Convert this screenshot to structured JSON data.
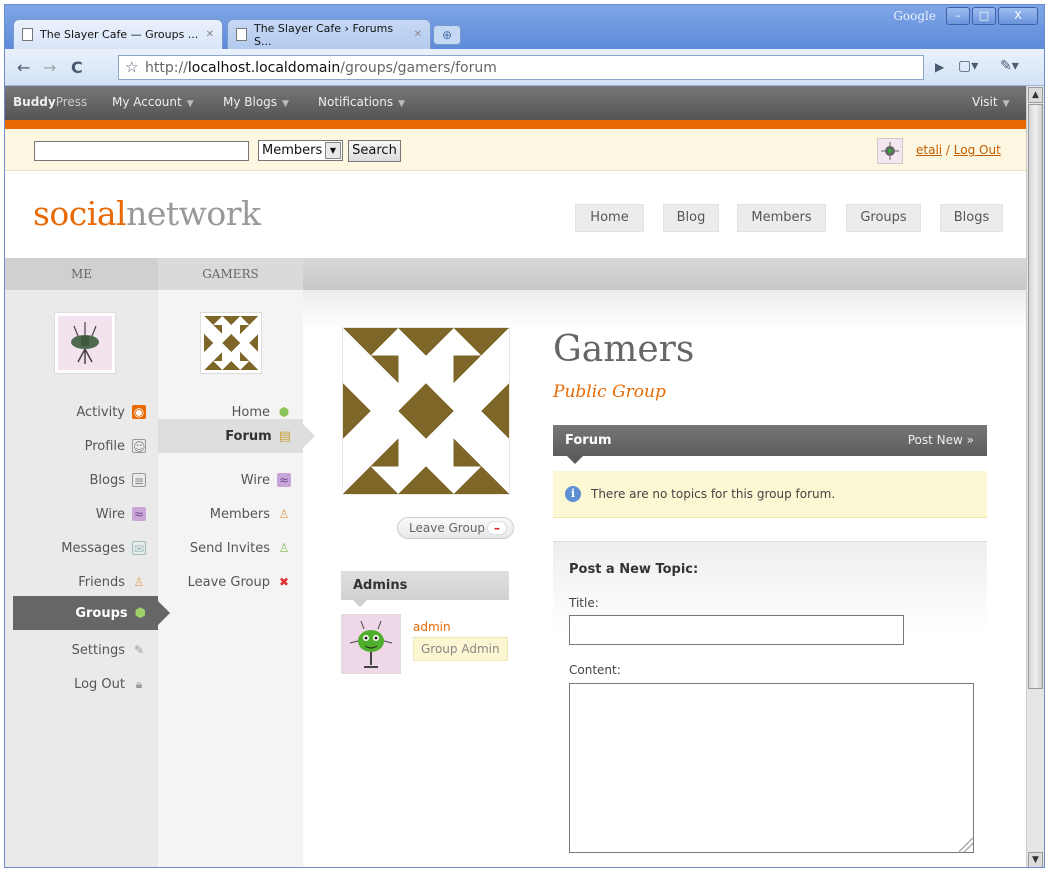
{
  "browser": {
    "tabs": [
      {
        "title": "The Slayer Cafe — Groups ..."
      },
      {
        "title": "The Slayer Cafe › Forums S..."
      }
    ],
    "brand_label": "Google",
    "url_prefix": "http://",
    "url_host": "localhost.localdomain",
    "url_path": "/groups/gamers/forum"
  },
  "adminbar": {
    "brand_a": "Buddy",
    "brand_b": "Press",
    "items": [
      "My Account",
      "My Blogs",
      "Notifications"
    ],
    "visit": "Visit"
  },
  "search": {
    "input_value": "",
    "scope": "Members",
    "button": "Search"
  },
  "user": {
    "name": "etali",
    "separator": " / ",
    "logout": "Log Out"
  },
  "header": {
    "logo_a": "social",
    "logo_b": "network",
    "nav": [
      "Home",
      "Blog",
      "Members",
      "Groups",
      "Blogs"
    ]
  },
  "columns": {
    "me_label": "ME",
    "group_label": "GAMERS"
  },
  "me_menu": {
    "items": [
      "Activity",
      "Profile",
      "Blogs",
      "Wire",
      "Messages",
      "Friends",
      "Groups",
      "Settings",
      "Log Out"
    ],
    "active": "Groups"
  },
  "group_menu": {
    "items": [
      "Home",
      "Forum",
      "Wire",
      "Members",
      "Send Invites",
      "Leave Group"
    ],
    "active": "Forum"
  },
  "group": {
    "name": "Gamers",
    "type": "Public Group",
    "leave_button": "Leave Group",
    "admins_heading": "Admins",
    "admin_name": "admin",
    "admin_badge": "Group Admin"
  },
  "forum": {
    "heading": "Forum",
    "post_new": "Post New »",
    "notice": "There are no topics for this group forum.",
    "post_heading": "Post a New Topic:",
    "title_label": "Title:",
    "content_label": "Content:",
    "title_value": "",
    "content_value": ""
  },
  "colors": {
    "accent": "#e86a05",
    "adminbar": "#5c5c5c",
    "notice_bg": "#fcf8d4"
  }
}
